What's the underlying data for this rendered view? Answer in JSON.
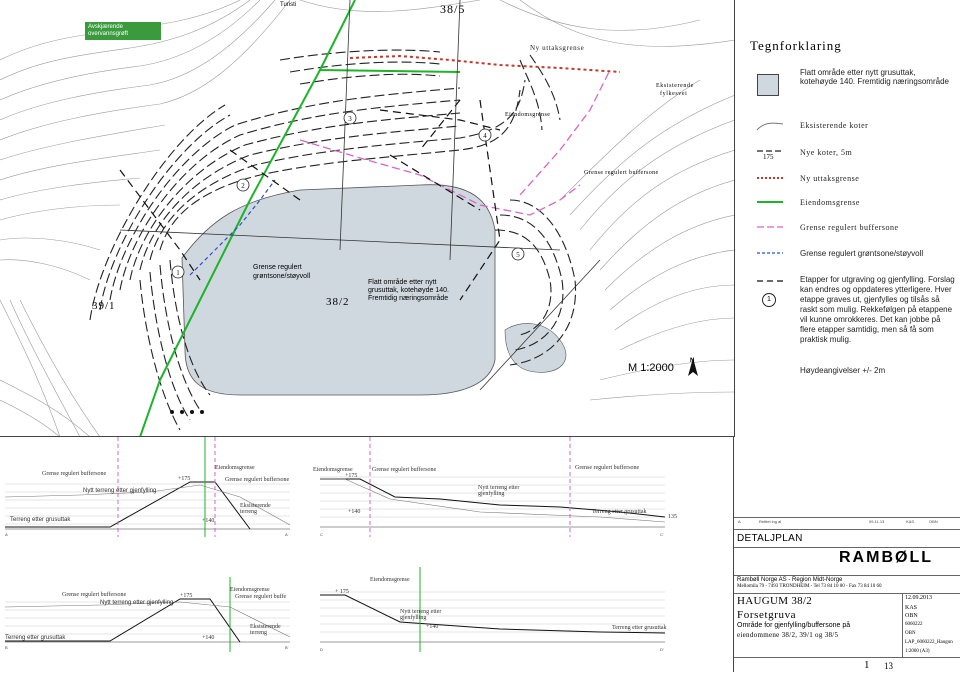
{
  "map": {
    "labels": {
      "property_top": "38/5",
      "property_left": "39/1",
      "property_center": "38/2",
      "avviklet": "Avskjærende overvannsgrøft",
      "turisti": "Turisti",
      "ny_uttak": "Ny uttaksgrense",
      "eksisterende_fylkesvei_1": "Eksisterende",
      "eksisterende_fylkesvei_2": "fylkesvei",
      "eiendomsgrense": "Eiendomsgrense",
      "grense_buffer": "Grense regulert buffersone",
      "grense_gront_1": "Grense regulert",
      "grense_gront_2": "grøntsone/støyvoll",
      "flatt_1": "Flatt område etter nytt",
      "flatt_2": "grusuttak, kotehøyde 140.",
      "flatt_3": "Fremtidig næringsområde",
      "scale": "M 1:2000",
      "north": "N"
    },
    "stages": [
      "1",
      "2",
      "3",
      "4",
      "5"
    ],
    "contour_labels": [
      "169",
      "166",
      "175",
      "156",
      "157",
      "155",
      "157",
      "157,5",
      "142",
      "180",
      "185",
      "175",
      "170",
      "165",
      "160",
      "155",
      "150",
      "145",
      "140",
      "167",
      "170",
      "175",
      "175",
      "169"
    ]
  },
  "legend": {
    "title": "Tegnforklaring",
    "items": [
      {
        "text": "Flatt område etter nytt grusuttak, kotehøyde 140. Fremtidig næringsområde",
        "kind": "flat"
      },
      {
        "text": "Eksisterende koter",
        "kind": "existing"
      },
      {
        "text": "Nye koter, 5m",
        "kind": "newc",
        "num": "175"
      },
      {
        "text": "Ny uttaksgrense",
        "kind": "red"
      },
      {
        "text": "Eiendomsgrense",
        "kind": "green"
      },
      {
        "text": "Grense regulert buffersone",
        "kind": "pink"
      },
      {
        "text": "Grense regulert grøntsone/støyvoll",
        "kind": "blue"
      },
      {
        "text": "Etapper for utgraving og gjenfylling. Forslag kan endres og oppdateres ytterligere. Hver etappe graves ut, gjenfylles og tilsås så raskt som mulig. Rekkefølgen på etappene vil kunne omrokkeres. Det kan jobbe på flere etapper samtidig, men så få som praktisk mulig.",
        "kind": "stage",
        "num": "1"
      }
    ],
    "height_note": "Høydeangivelser +/- 2m"
  },
  "sections": {
    "a": {
      "buffer": "Grense regulert buffersone",
      "eiendom": "Eiendomsgrense",
      "buffer2": "Grense regulert buffersone",
      "nytt": "Nytt terreng etter gjenfylling",
      "terreng": "Terreng etter grusuttak",
      "eksist": "Eksisterende terreng",
      "p175": "+175",
      "p140": "+140",
      "from": "A",
      "to": "A'"
    },
    "c": {
      "eiendom": "Eiendomsgrense",
      "buffer1": "Grense regulert buffersone",
      "buffer2": "Grense regulert buffersone",
      "nytt": "Nytt terreng etter gjenfylling",
      "terreng": "Terreng etter grusuttak",
      "p175": "+175",
      "p140": "+140",
      "p135": "135",
      "from": "C",
      "to": "C'"
    },
    "b": {
      "buffer": "Grense regulert buffersone",
      "eiendom": "Eiendomsgrense",
      "buffer2": "Grense regulert buffe",
      "nytt": "Nytt terreng etter gjenfylling",
      "terreng": "Terreng etter grusuttak",
      "eksist": "Eksisterende terreng",
      "p175": "+175",
      "p140": "+140",
      "from": "B",
      "to": "B'"
    },
    "d": {
      "eiendom": "Eiendomsgrense",
      "nytt": "Nytt terreng etter gjenfylling",
      "terreng": "Terreng etter grusuttak",
      "p175": "+ 175",
      "p140": "+140",
      "from": "D",
      "to": "D'"
    },
    "elev_ticks": [
      "175",
      "170",
      "165",
      "160",
      "155",
      "150",
      "145",
      "140",
      "135"
    ]
  },
  "titleblock": {
    "rev_row": "A",
    "rev_desc": "Rettlet ing al",
    "rev_date": "09.11.13",
    "rev_a": "KAS",
    "rev_b": "OBN",
    "detaljplan": "DETALJPLAN",
    "brand": "RAMBØLL",
    "company": "Rambøll Norge AS - Region Midt-Norge",
    "address": "Mellomila 79 - 7493 TRONDHEIM - Tel 73 84 10 00 - Fax 73 84 10 60",
    "project": "HAUGUM 38/2",
    "sub": "Forsetgruva",
    "desc1": "Område for gjenfylling/buffersone på",
    "desc2": "eiendommene 38/2, 39/1 og 38/5",
    "date": "12.09.2013",
    "drawn": "KAS",
    "checked": "OBN",
    "projno": "6060222",
    "approved": "OBN",
    "file": "LAP_6060222_Haugun",
    "scale": "1:2000 (A3)",
    "sheet": "1",
    "sheet_of": "13"
  }
}
